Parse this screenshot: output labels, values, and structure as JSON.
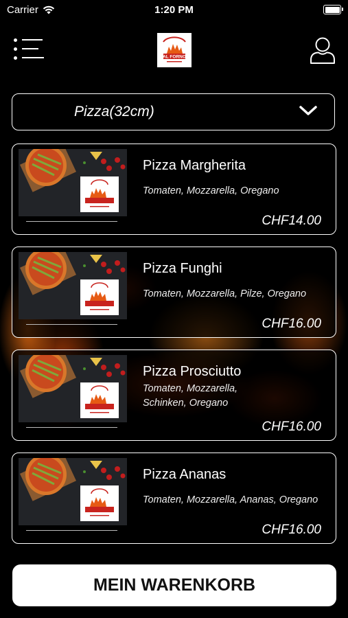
{
  "status_bar": {
    "carrier": "Carrier",
    "time": "1:20 PM"
  },
  "header": {
    "logo_text": "AL FORNO",
    "menu_icon": "menu-icon",
    "user_icon": "user-icon"
  },
  "category_select": {
    "selected": "Pizza(32cm)"
  },
  "products": [
    {
      "name": "Pizza Margherita",
      "description": "Tomaten, Mozzarella, Oregano",
      "price": "CHF14.00"
    },
    {
      "name": "Pizza Funghi",
      "description": "Tomaten, Mozzarella, Pilze, Oregano",
      "price": "CHF16.00"
    },
    {
      "name": "Pizza Prosciutto",
      "description": "Tomaten, Mozzarella, Schinken, Oregano",
      "price": "CHF16.00"
    },
    {
      "name": "Pizza Ananas",
      "description": "Tomaten, Mozzarella, Ananas, Oregano",
      "price": "CHF16.00"
    }
  ],
  "cart_button": {
    "label": "MEIN WARENKORB"
  },
  "colors": {
    "background": "#000000",
    "text": "#ffffff",
    "logo_red": "#c8231e"
  }
}
